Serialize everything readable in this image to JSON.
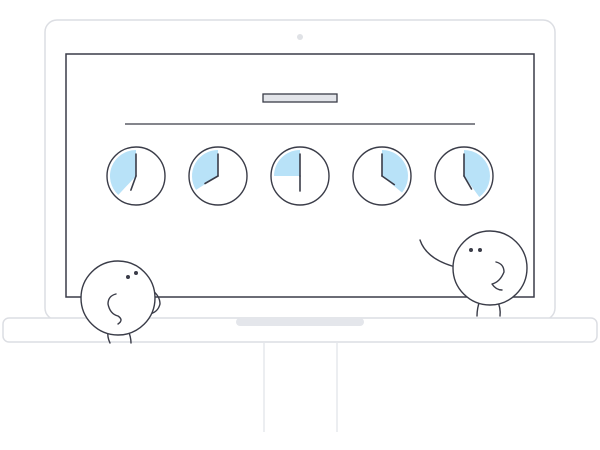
{
  "colors": {
    "background": "#ffffff",
    "line": "#3a3c48",
    "laptop_outline": "#dcdee3",
    "trackpad": "#e4e6eb",
    "title_bar_fill": "#e3e5ea",
    "clock_fill": "#b8e2f8"
  },
  "clocks": [
    {
      "fill_fraction": 0.38,
      "hour_hand_deg": 0,
      "minute_hand_deg": 200
    },
    {
      "fill_fraction": 0.34,
      "hour_hand_deg": 0,
      "minute_hand_deg": 240
    },
    {
      "fill_fraction": 0.25,
      "hour_hand_deg": 0,
      "minute_hand_deg": 180
    },
    {
      "fill_fraction": 0.36,
      "hour_hand_deg": 0,
      "minute_hand_deg": 125
    },
    {
      "fill_fraction": 0.4,
      "hour_hand_deg": 0,
      "minute_hand_deg": 150
    }
  ],
  "icons": {
    "left_character": "round-character-icon",
    "right_character": "round-character-waving-icon",
    "clock": "clock-icon",
    "webcam": "webcam-icon"
  }
}
